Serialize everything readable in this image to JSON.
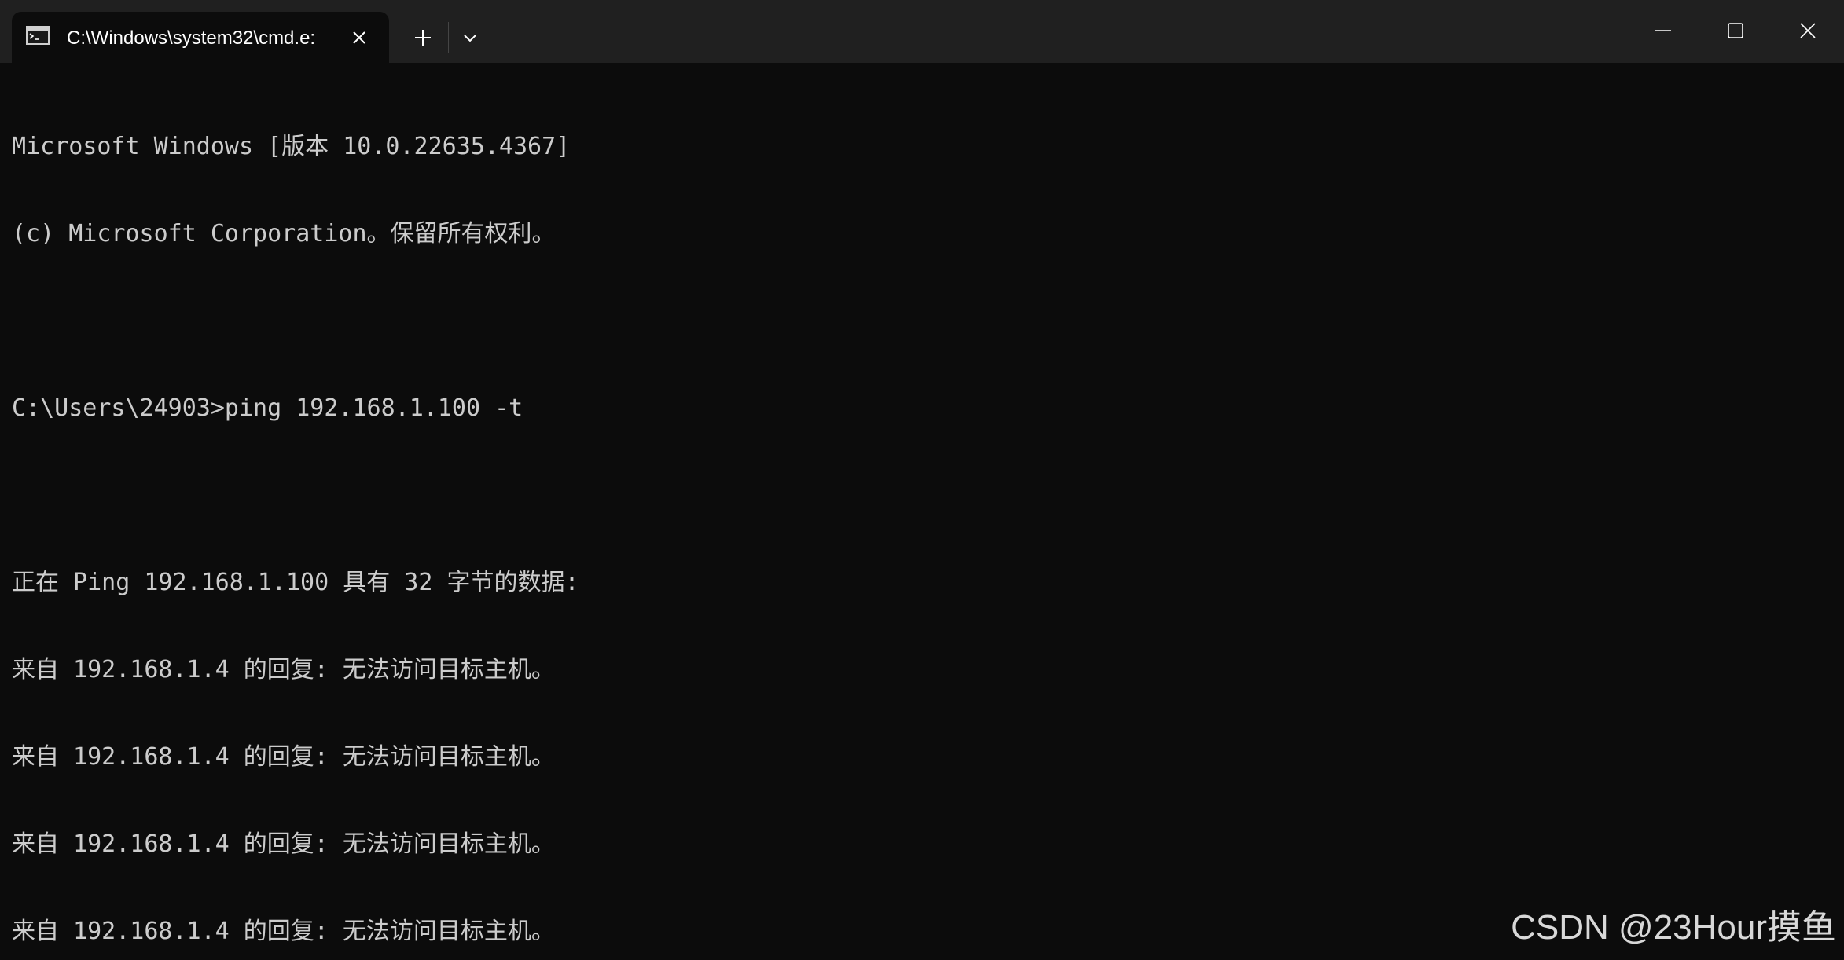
{
  "titlebar": {
    "tab_title": "C:\\Windows\\system32\\cmd.e:",
    "tab_icon": "cmd-prompt-icon",
    "close_tab_icon": "close-icon",
    "new_tab_icon": "plus-icon",
    "dropdown_icon": "chevron-down-icon",
    "window_controls": [
      "minimize-icon",
      "maximize-icon",
      "close-icon"
    ]
  },
  "console": {
    "lines": [
      "Microsoft Windows [版本 10.0.22635.4367]",
      "(c) Microsoft Corporation。保留所有权利。",
      "",
      "C:\\Users\\24903>ping 192.168.1.100 -t",
      "",
      "正在 Ping 192.168.1.100 具有 32 字节的数据:",
      "来自 192.168.1.4 的回复: 无法访问目标主机。",
      "来自 192.168.1.4 的回复: 无法访问目标主机。",
      "来自 192.168.1.4 的回复: 无法访问目标主机。",
      "来自 192.168.1.4 的回复: 无法访问目标主机。"
    ]
  },
  "watermark": "CSDN @23Hour摸鱼",
  "colors": {
    "titlebar_bg": "#202020",
    "console_bg": "#0c0c0c",
    "console_text": "#cccccc"
  }
}
